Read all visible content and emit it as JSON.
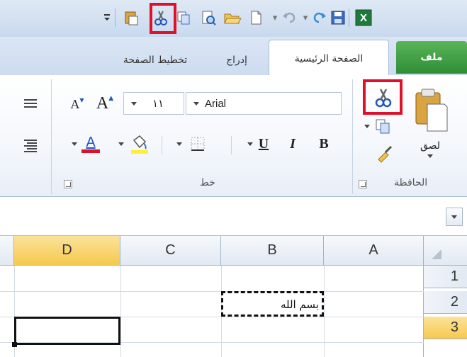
{
  "qat": {
    "items": [
      "excel-logo",
      "save",
      "redo",
      "undo",
      "new",
      "open",
      "print-preview",
      "copy",
      "cut",
      "paste",
      "customize"
    ]
  },
  "tabs": {
    "file": "ملف",
    "home": "الصفحة الرئيسية",
    "insert": "إدراج",
    "page_layout": "تخطيط الصفحة"
  },
  "clipboard": {
    "paste_label": "لصق",
    "group_label": "الحافظة"
  },
  "font": {
    "name": "Arial",
    "size": "١١",
    "group_label": "خط",
    "bold": "B",
    "italic": "I",
    "underline": "U",
    "grow": "A",
    "shrink": "A",
    "font_color": "A"
  },
  "grid": {
    "columns": [
      "A",
      "B",
      "C",
      "D"
    ],
    "active_column": "D",
    "rows": [
      "1",
      "2",
      "3"
    ],
    "active_row": "3",
    "cells": {
      "B2": "بسم الله"
    }
  },
  "colors": {
    "highlight": "#e0102a",
    "file_tab": "#3a9a3e",
    "active_header": "#f6c94e",
    "font_color_bar": "#e0102a",
    "fill_color_bar": "#ffee33"
  }
}
